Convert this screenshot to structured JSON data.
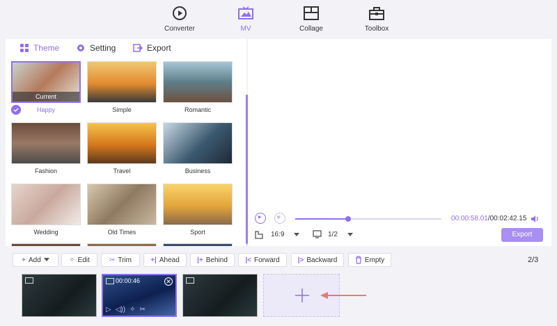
{
  "nav": {
    "items": [
      {
        "label": "Converter",
        "icon": "converter-icon"
      },
      {
        "label": "MV",
        "icon": "mv-icon",
        "active": true
      },
      {
        "label": "Collage",
        "icon": "collage-icon"
      },
      {
        "label": "Toolbox",
        "icon": "toolbox-icon"
      }
    ]
  },
  "tabs": [
    {
      "label": "Theme",
      "icon": "theme-icon",
      "active": true
    },
    {
      "label": "Setting",
      "icon": "gear-icon"
    },
    {
      "label": "Export",
      "icon": "export-icon"
    }
  ],
  "themes": [
    {
      "label": "Happy",
      "current_label": "Current",
      "selected": true
    },
    {
      "label": "Simple"
    },
    {
      "label": "Romantic"
    },
    {
      "label": "Fashion"
    },
    {
      "label": "Travel"
    },
    {
      "label": "Business"
    },
    {
      "label": "Wedding"
    },
    {
      "label": "Old Times"
    },
    {
      "label": "Sport"
    }
  ],
  "player": {
    "current_time": "00:00:58.01",
    "total_time": "/00:02:42.15",
    "progress": 0.36,
    "aspect": "16:9",
    "page": "1/2",
    "export_label": "Export"
  },
  "toolbar": {
    "add": "Add",
    "edit": "Edit",
    "trim": "Trim",
    "ahead": "Ahead",
    "behind": "Behind",
    "forward": "Forward",
    "backward": "Backward",
    "empty": "Empty",
    "page_current": "2",
    "page_total": "/3"
  },
  "clips": [
    {
      "time": ""
    },
    {
      "time": "00:00:46",
      "active": true
    },
    {
      "time": ""
    }
  ],
  "colors": {
    "accent": "#8f6ff0",
    "export_button": "#a98ef3"
  }
}
